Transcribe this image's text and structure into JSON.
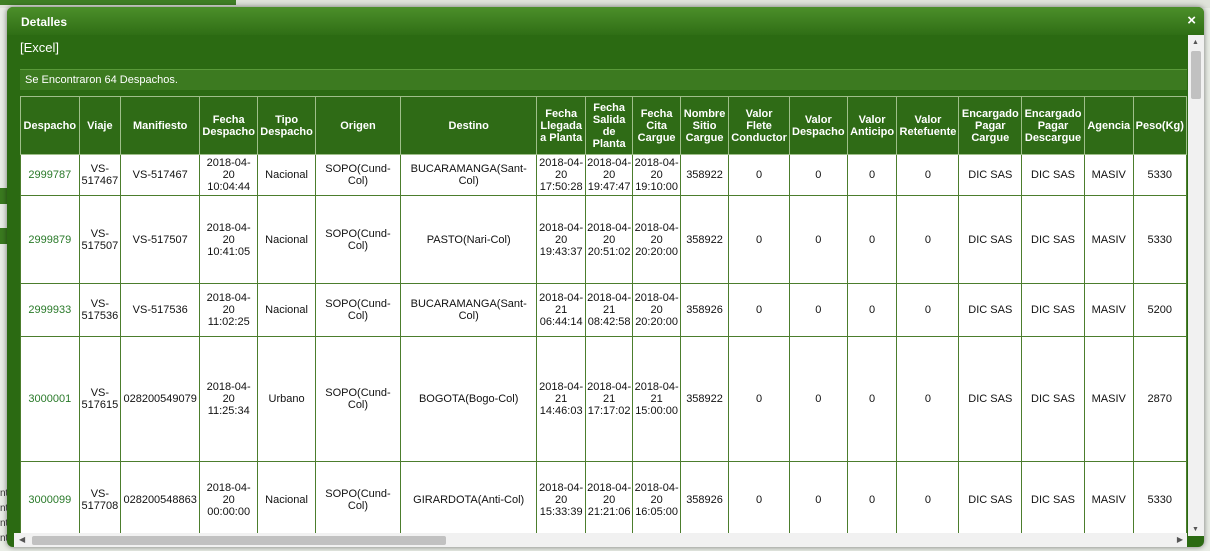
{
  "dialog": {
    "title": "Detalles",
    "close_icon": "×",
    "excel_link": "[Excel]",
    "count_text": "Se Encontraron 64 Despachos."
  },
  "columns": [
    "Despacho",
    "Viaje",
    "Manifiesto",
    "Fecha Despacho",
    "Tipo Despacho",
    "Origen",
    "Destino",
    "Fecha Llegada a Planta",
    "Fecha Salida de Planta",
    "Fecha Cita Cargue",
    "Nombre Sitio Cargue",
    "Valor Flete Conductor",
    "Valor Despacho",
    "Valor Anticipo",
    "Valor Retefuente",
    "Encargado Pagar Cargue",
    "Encargado Pagar Descargue",
    "Agencia",
    "Peso(Kg)"
  ],
  "rows": [
    [
      "2999787",
      "VS-517467",
      "VS-517467",
      "2018-04-20 10:04:44",
      "Nacional",
      "SOPO(Cund-Col)",
      "BUCARAMANGA(Sant-Col)",
      "2018-04-20 17:50:28",
      "2018-04-20 19:47:47",
      "2018-04-20 19:10:00",
      "358922",
      "0",
      "0",
      "0",
      "0",
      "DIC SAS",
      "DIC SAS",
      "MASIV",
      "5330"
    ],
    [
      "2999879",
      "VS-517507",
      "VS-517507",
      "2018-04-20 10:41:05",
      "Nacional",
      "SOPO(Cund-Col)",
      "PASTO(Nari-Col)",
      "2018-04-20 19:43:37",
      "2018-04-20 20:51:02",
      "2018-04-20 20:20:00",
      "358922",
      "0",
      "0",
      "0",
      "0",
      "DIC SAS",
      "DIC SAS",
      "MASIV",
      "5330"
    ],
    [
      "2999933",
      "VS-517536",
      "VS-517536",
      "2018-04-20 11:02:25",
      "Nacional",
      "SOPO(Cund-Col)",
      "BUCARAMANGA(Sant-Col)",
      "2018-04-21 06:44:14",
      "2018-04-21 08:42:58",
      "2018-04-20 20:20:00",
      "358926",
      "0",
      "0",
      "0",
      "0",
      "DIC SAS",
      "DIC SAS",
      "MASIV",
      "5200"
    ],
    [
      "3000001",
      "VS-517615",
      "028200549079",
      "2018-04-20 11:25:34",
      "Urbano",
      "SOPO(Cund-Col)",
      "BOGOTA(Bogo-Col)",
      "2018-04-21 14:46:03",
      "2018-04-21 17:17:02",
      "2018-04-21 15:00:00",
      "358922",
      "0",
      "0",
      "0",
      "0",
      "DIC SAS",
      "DIC SAS",
      "MASIV",
      "2870"
    ],
    [
      "3000099",
      "VS-517708",
      "028200548863",
      "2018-04-20 00:00:00",
      "Nacional",
      "SOPO(Cund-Col)",
      "GIRARDOTA(Anti-Col)",
      "2018-04-20 15:33:39",
      "2018-04-20 21:21:06",
      "2018-04-20 16:05:00",
      "358926",
      "0",
      "0",
      "0",
      "0",
      "DIC SAS",
      "DIC SAS",
      "MASIV",
      "5330"
    ]
  ],
  "background": {
    "left_fragments": [
      "nt",
      "nt",
      "nt",
      "nt"
    ]
  }
}
